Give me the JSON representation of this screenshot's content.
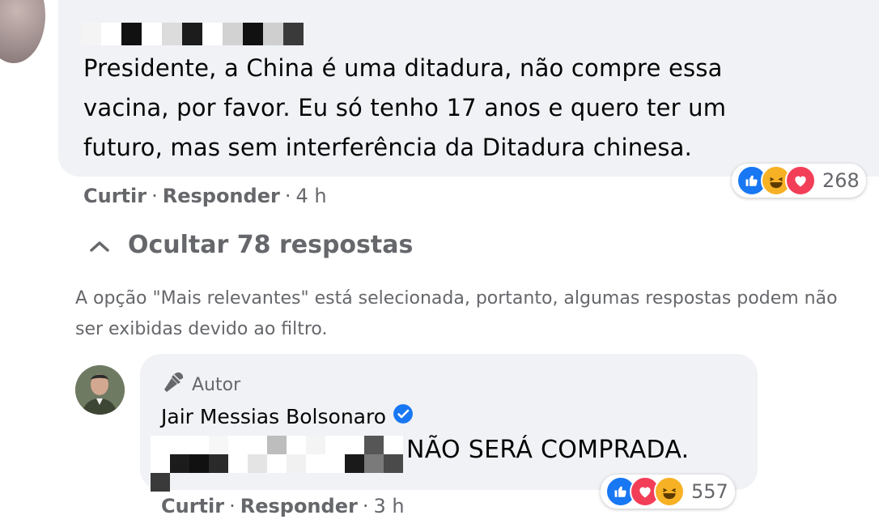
{
  "comment": {
    "text": "Presidente, a China é uma ditadura, não compre essa vacina, por favor. Eu só tenho 17 anos e quero ter um futuro, mas sem interferência da Ditadura chinesa.",
    "actions": {
      "like": "Curtir",
      "reply": "Responder",
      "time": "4 h"
    },
    "reactions": {
      "count": "268",
      "icons": [
        "like-icon",
        "haha-icon",
        "love-icon"
      ]
    }
  },
  "replies_toggle": {
    "label": "Ocultar 78 respostas",
    "icon": "chevron-up-icon"
  },
  "filter_note": "A opção \"Mais relevantes\" está selecionada, portanto, algumas respostas podem não ser exibidas devido ao filtro.",
  "reply": {
    "badge": "Autor",
    "author": "Jair Messias Bolsonaro",
    "text": "NÃO SERÁ COMPRADA.",
    "actions": {
      "like": "Curtir",
      "reply": "Responder",
      "time": "3 h"
    },
    "reactions": {
      "count": "557",
      "icons": [
        "like-icon",
        "love-icon",
        "haha-icon"
      ]
    }
  },
  "colors": {
    "bubble": "#f0f2f5",
    "meta_text": "#65676b",
    "like": "#1877f2",
    "love": "#f33e58",
    "haha": "#f7b125"
  }
}
